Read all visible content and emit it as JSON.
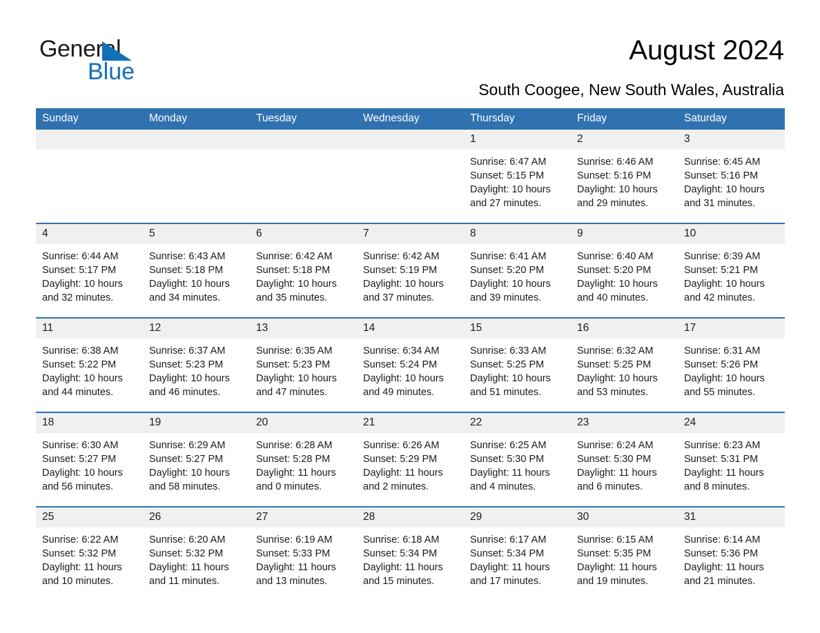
{
  "brand": {
    "name_part1": "General",
    "name_part2": "Blue",
    "accent_color": "#1270b8"
  },
  "header": {
    "title": "August 2024",
    "subtitle": "South Coogee, New South Wales, Australia"
  },
  "theme": {
    "header_blue": "#3071b0",
    "daynum_gray": "#f0f0f0",
    "text": "#1b1b1b"
  },
  "calendar": {
    "weekday_headers": [
      "Sunday",
      "Monday",
      "Tuesday",
      "Wednesday",
      "Thursday",
      "Friday",
      "Saturday"
    ],
    "weeks": [
      [
        {
          "day": "",
          "sunrise": "",
          "sunset": "",
          "daylight_line1": "",
          "daylight_line2": "",
          "empty": true
        },
        {
          "day": "",
          "sunrise": "",
          "sunset": "",
          "daylight_line1": "",
          "daylight_line2": "",
          "empty": true
        },
        {
          "day": "",
          "sunrise": "",
          "sunset": "",
          "daylight_line1": "",
          "daylight_line2": "",
          "empty": true
        },
        {
          "day": "",
          "sunrise": "",
          "sunset": "",
          "daylight_line1": "",
          "daylight_line2": "",
          "empty": true
        },
        {
          "day": "1",
          "sunrise": "Sunrise: 6:47 AM",
          "sunset": "Sunset: 5:15 PM",
          "daylight_line1": "Daylight: 10 hours",
          "daylight_line2": "and 27 minutes.",
          "empty": false
        },
        {
          "day": "2",
          "sunrise": "Sunrise: 6:46 AM",
          "sunset": "Sunset: 5:16 PM",
          "daylight_line1": "Daylight: 10 hours",
          "daylight_line2": "and 29 minutes.",
          "empty": false
        },
        {
          "day": "3",
          "sunrise": "Sunrise: 6:45 AM",
          "sunset": "Sunset: 5:16 PM",
          "daylight_line1": "Daylight: 10 hours",
          "daylight_line2": "and 31 minutes.",
          "empty": false
        }
      ],
      [
        {
          "day": "4",
          "sunrise": "Sunrise: 6:44 AM",
          "sunset": "Sunset: 5:17 PM",
          "daylight_line1": "Daylight: 10 hours",
          "daylight_line2": "and 32 minutes.",
          "empty": false
        },
        {
          "day": "5",
          "sunrise": "Sunrise: 6:43 AM",
          "sunset": "Sunset: 5:18 PM",
          "daylight_line1": "Daylight: 10 hours",
          "daylight_line2": "and 34 minutes.",
          "empty": false
        },
        {
          "day": "6",
          "sunrise": "Sunrise: 6:42 AM",
          "sunset": "Sunset: 5:18 PM",
          "daylight_line1": "Daylight: 10 hours",
          "daylight_line2": "and 35 minutes.",
          "empty": false
        },
        {
          "day": "7",
          "sunrise": "Sunrise: 6:42 AM",
          "sunset": "Sunset: 5:19 PM",
          "daylight_line1": "Daylight: 10 hours",
          "daylight_line2": "and 37 minutes.",
          "empty": false
        },
        {
          "day": "8",
          "sunrise": "Sunrise: 6:41 AM",
          "sunset": "Sunset: 5:20 PM",
          "daylight_line1": "Daylight: 10 hours",
          "daylight_line2": "and 39 minutes.",
          "empty": false
        },
        {
          "day": "9",
          "sunrise": "Sunrise: 6:40 AM",
          "sunset": "Sunset: 5:20 PM",
          "daylight_line1": "Daylight: 10 hours",
          "daylight_line2": "and 40 minutes.",
          "empty": false
        },
        {
          "day": "10",
          "sunrise": "Sunrise: 6:39 AM",
          "sunset": "Sunset: 5:21 PM",
          "daylight_line1": "Daylight: 10 hours",
          "daylight_line2": "and 42 minutes.",
          "empty": false
        }
      ],
      [
        {
          "day": "11",
          "sunrise": "Sunrise: 6:38 AM",
          "sunset": "Sunset: 5:22 PM",
          "daylight_line1": "Daylight: 10 hours",
          "daylight_line2": "and 44 minutes.",
          "empty": false
        },
        {
          "day": "12",
          "sunrise": "Sunrise: 6:37 AM",
          "sunset": "Sunset: 5:23 PM",
          "daylight_line1": "Daylight: 10 hours",
          "daylight_line2": "and 46 minutes.",
          "empty": false
        },
        {
          "day": "13",
          "sunrise": "Sunrise: 6:35 AM",
          "sunset": "Sunset: 5:23 PM",
          "daylight_line1": "Daylight: 10 hours",
          "daylight_line2": "and 47 minutes.",
          "empty": false
        },
        {
          "day": "14",
          "sunrise": "Sunrise: 6:34 AM",
          "sunset": "Sunset: 5:24 PM",
          "daylight_line1": "Daylight: 10 hours",
          "daylight_line2": "and 49 minutes.",
          "empty": false
        },
        {
          "day": "15",
          "sunrise": "Sunrise: 6:33 AM",
          "sunset": "Sunset: 5:25 PM",
          "daylight_line1": "Daylight: 10 hours",
          "daylight_line2": "and 51 minutes.",
          "empty": false
        },
        {
          "day": "16",
          "sunrise": "Sunrise: 6:32 AM",
          "sunset": "Sunset: 5:25 PM",
          "daylight_line1": "Daylight: 10 hours",
          "daylight_line2": "and 53 minutes.",
          "empty": false
        },
        {
          "day": "17",
          "sunrise": "Sunrise: 6:31 AM",
          "sunset": "Sunset: 5:26 PM",
          "daylight_line1": "Daylight: 10 hours",
          "daylight_line2": "and 55 minutes.",
          "empty": false
        }
      ],
      [
        {
          "day": "18",
          "sunrise": "Sunrise: 6:30 AM",
          "sunset": "Sunset: 5:27 PM",
          "daylight_line1": "Daylight: 10 hours",
          "daylight_line2": "and 56 minutes.",
          "empty": false
        },
        {
          "day": "19",
          "sunrise": "Sunrise: 6:29 AM",
          "sunset": "Sunset: 5:27 PM",
          "daylight_line1": "Daylight: 10 hours",
          "daylight_line2": "and 58 minutes.",
          "empty": false
        },
        {
          "day": "20",
          "sunrise": "Sunrise: 6:28 AM",
          "sunset": "Sunset: 5:28 PM",
          "daylight_line1": "Daylight: 11 hours",
          "daylight_line2": "and 0 minutes.",
          "empty": false
        },
        {
          "day": "21",
          "sunrise": "Sunrise: 6:26 AM",
          "sunset": "Sunset: 5:29 PM",
          "daylight_line1": "Daylight: 11 hours",
          "daylight_line2": "and 2 minutes.",
          "empty": false
        },
        {
          "day": "22",
          "sunrise": "Sunrise: 6:25 AM",
          "sunset": "Sunset: 5:30 PM",
          "daylight_line1": "Daylight: 11 hours",
          "daylight_line2": "and 4 minutes.",
          "empty": false
        },
        {
          "day": "23",
          "sunrise": "Sunrise: 6:24 AM",
          "sunset": "Sunset: 5:30 PM",
          "daylight_line1": "Daylight: 11 hours",
          "daylight_line2": "and 6 minutes.",
          "empty": false
        },
        {
          "day": "24",
          "sunrise": "Sunrise: 6:23 AM",
          "sunset": "Sunset: 5:31 PM",
          "daylight_line1": "Daylight: 11 hours",
          "daylight_line2": "and 8 minutes.",
          "empty": false
        }
      ],
      [
        {
          "day": "25",
          "sunrise": "Sunrise: 6:22 AM",
          "sunset": "Sunset: 5:32 PM",
          "daylight_line1": "Daylight: 11 hours",
          "daylight_line2": "and 10 minutes.",
          "empty": false
        },
        {
          "day": "26",
          "sunrise": "Sunrise: 6:20 AM",
          "sunset": "Sunset: 5:32 PM",
          "daylight_line1": "Daylight: 11 hours",
          "daylight_line2": "and 11 minutes.",
          "empty": false
        },
        {
          "day": "27",
          "sunrise": "Sunrise: 6:19 AM",
          "sunset": "Sunset: 5:33 PM",
          "daylight_line1": "Daylight: 11 hours",
          "daylight_line2": "and 13 minutes.",
          "empty": false
        },
        {
          "day": "28",
          "sunrise": "Sunrise: 6:18 AM",
          "sunset": "Sunset: 5:34 PM",
          "daylight_line1": "Daylight: 11 hours",
          "daylight_line2": "and 15 minutes.",
          "empty": false
        },
        {
          "day": "29",
          "sunrise": "Sunrise: 6:17 AM",
          "sunset": "Sunset: 5:34 PM",
          "daylight_line1": "Daylight: 11 hours",
          "daylight_line2": "and 17 minutes.",
          "empty": false
        },
        {
          "day": "30",
          "sunrise": "Sunrise: 6:15 AM",
          "sunset": "Sunset: 5:35 PM",
          "daylight_line1": "Daylight: 11 hours",
          "daylight_line2": "and 19 minutes.",
          "empty": false
        },
        {
          "day": "31",
          "sunrise": "Sunrise: 6:14 AM",
          "sunset": "Sunset: 5:36 PM",
          "daylight_line1": "Daylight: 11 hours",
          "daylight_line2": "and 21 minutes.",
          "empty": false
        }
      ]
    ]
  }
}
